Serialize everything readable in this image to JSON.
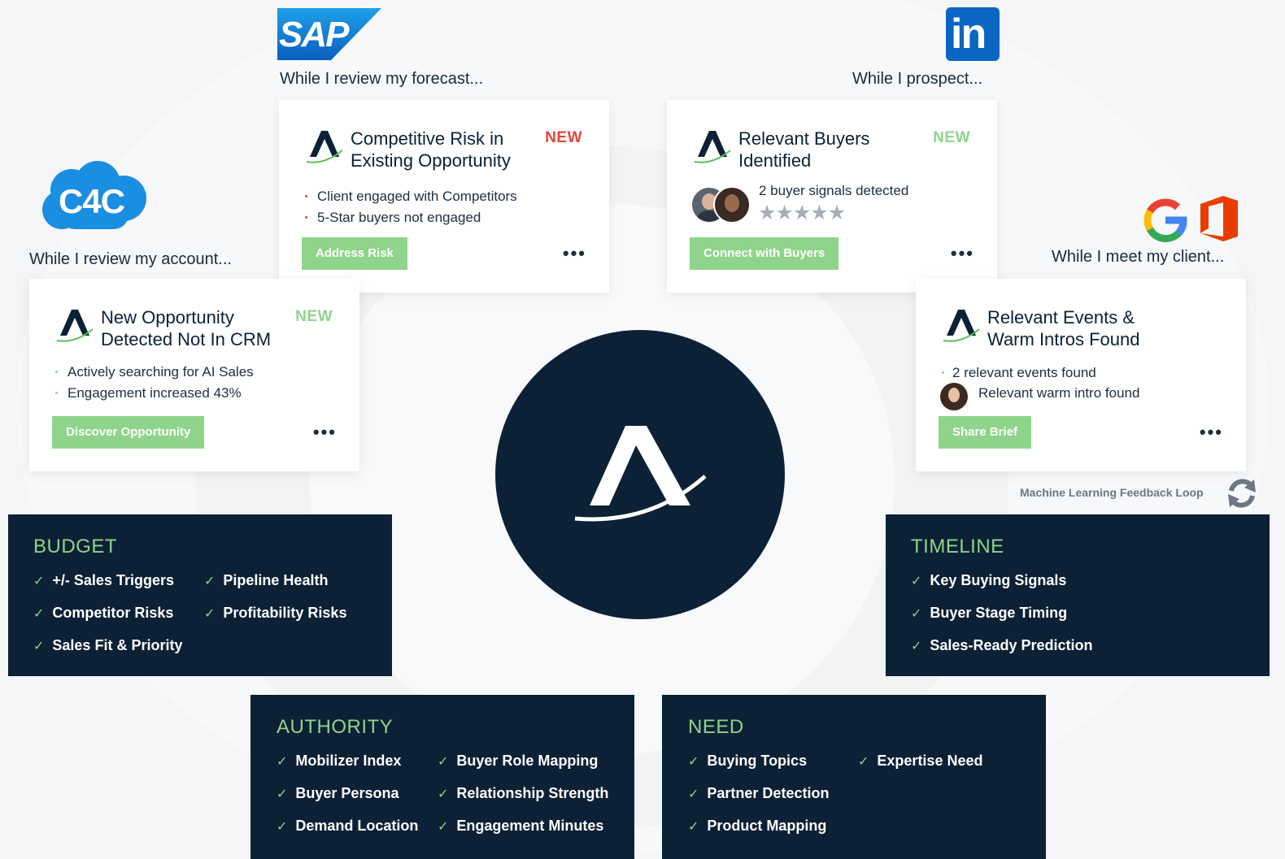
{
  "colors": {
    "navy": "#0c2036",
    "green": "#8fd48a",
    "red": "#e5463d",
    "background": "#f4f5f7"
  },
  "logos": {
    "sap": "SAP",
    "linkedin": "in",
    "c4c": "C4C"
  },
  "captions": {
    "forecast": "While I review my forecast...",
    "prospect": "While I prospect...",
    "account": "While I review my account...",
    "client": "While I meet my client..."
  },
  "cards": {
    "competitive": {
      "title": "Competitive Risk in Existing Opportunity",
      "badge": "NEW",
      "bullets": [
        "Client engaged with Competitors",
        "5-Star buyers not engaged"
      ],
      "cta": "Address Risk"
    },
    "buyers": {
      "title": "Relevant Buyers Identified",
      "badge": "NEW",
      "signals": "2 buyer signals detected",
      "rating": 0,
      "rating_max": 5,
      "cta": "Connect with Buyers"
    },
    "opportunity": {
      "title": "New Opportunity Detected Not In CRM",
      "badge": "NEW",
      "bullets": [
        "Actively searching for AI Sales",
        "Engagement increased 43%"
      ],
      "cta": "Discover Opportunity"
    },
    "events": {
      "title": "Relevant Events & Warm Intros Found",
      "bullets": [
        "2 relevant events found",
        "Relevant warm intro found"
      ],
      "cta": "Share Brief"
    }
  },
  "feedback_loop": "Machine Learning Feedback Loop",
  "panels": {
    "budget": {
      "title": "BUDGET",
      "items": [
        "+/- Sales Triggers",
        "Pipeline Health",
        "Competitor Risks",
        "Profitability Risks",
        "Sales Fit & Priority"
      ]
    },
    "timeline": {
      "title": "TIMELINE",
      "items": [
        "Key Buying Signals",
        "Buyer Stage Timing",
        "Sales-Ready Prediction"
      ]
    },
    "authority": {
      "title": "AUTHORITY",
      "items": [
        "Mobilizer Index",
        "Buyer Role Mapping",
        "Buyer Persona",
        "Relationship Strength",
        "Demand Location",
        "Engagement Minutes"
      ]
    },
    "need": {
      "title": "NEED",
      "items": [
        "Buying Topics",
        "Expertise Need",
        "Partner Detection",
        "Product Mapping"
      ]
    }
  },
  "icons": [
    "sap-logo",
    "linkedin-logo",
    "c4c-cloud-logo",
    "google-logo",
    "office-logo",
    "brand-logo",
    "refresh-icon",
    "check-icon",
    "more-icon",
    "star-icon"
  ]
}
